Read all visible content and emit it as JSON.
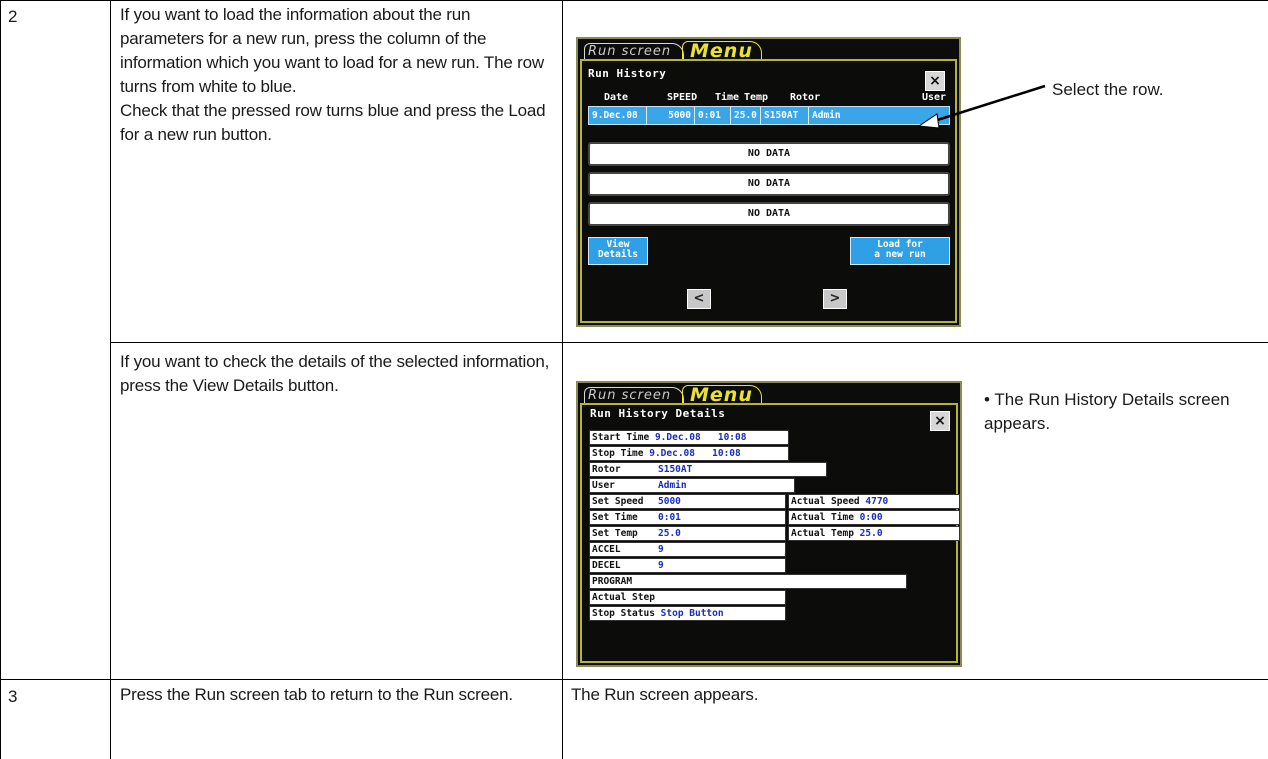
{
  "steps": [
    {
      "number": "2",
      "a_text": "If you want to load the information about the run parameters for a new run, press the column of the information which you want to load for a new run. The row turns from white to blue.\nCheck that the pressed row turns blue and press the Load for a new run button.",
      "a_annotation": "Select the row.",
      "b_text": "If you want to check the details of the selected information, press the View Details button.",
      "b_annotation": "• The Run History Details screen appears."
    },
    {
      "number": "3",
      "text": "Press the Run screen tab to return to the Run screen.",
      "result": "The Run screen appears."
    }
  ],
  "history_screen": {
    "tab_run": "Run screen",
    "tab_menu": "Menu",
    "title": "Run History",
    "close": "×",
    "headers": [
      "Date",
      "SPEED",
      "Time",
      "Temp",
      "Rotor",
      "User"
    ],
    "selected_row": [
      "9.Dec.08",
      "5000",
      "0:01",
      "25.0",
      "S150AT",
      "Admin"
    ],
    "empty_rows": [
      "NO DATA",
      "NO DATA",
      "NO DATA"
    ],
    "view_details": "View\nDetails",
    "load_new_run": "Load for\na new run",
    "prev": "<",
    "next": ">"
  },
  "details_screen": {
    "tab_run": "Run screen",
    "tab_menu": "Menu",
    "title": "Run History Details",
    "close": "×",
    "start_time_label": "Start Time",
    "start_time_value": "9.Dec.08   10:08",
    "stop_time_label": "Stop Time",
    "stop_time_value": "9.Dec.08   10:08",
    "rotor_label": "Rotor",
    "rotor_value": "S150AT",
    "user_label": "User",
    "user_value": "Admin",
    "set_speed_label": "Set Speed",
    "set_speed_value": "5000",
    "set_time_label": "Set Time",
    "set_time_value": "0:01",
    "set_temp_label": "Set Temp",
    "set_temp_value": "25.0",
    "actual_speed_label": "Actual Speed",
    "actual_speed_value": "4770",
    "actual_time_label": "Actual Time",
    "actual_time_value": "0:00",
    "actual_temp_label": "Actual Temp",
    "actual_temp_value": "25.0",
    "accel_label": "ACCEL",
    "accel_value": "9",
    "decel_label": "DECEL",
    "decel_value": "9",
    "program_label": "PROGRAM",
    "actual_step_label": "Actual Step",
    "stop_status_label": "Stop Status",
    "stop_status_value": "Stop Button"
  },
  "colors": {
    "screen_bg": "#0c0c0a",
    "menu_tab": "#e8e233",
    "selected_row": "#3aa6e8",
    "value_text": "#1b2db8"
  }
}
